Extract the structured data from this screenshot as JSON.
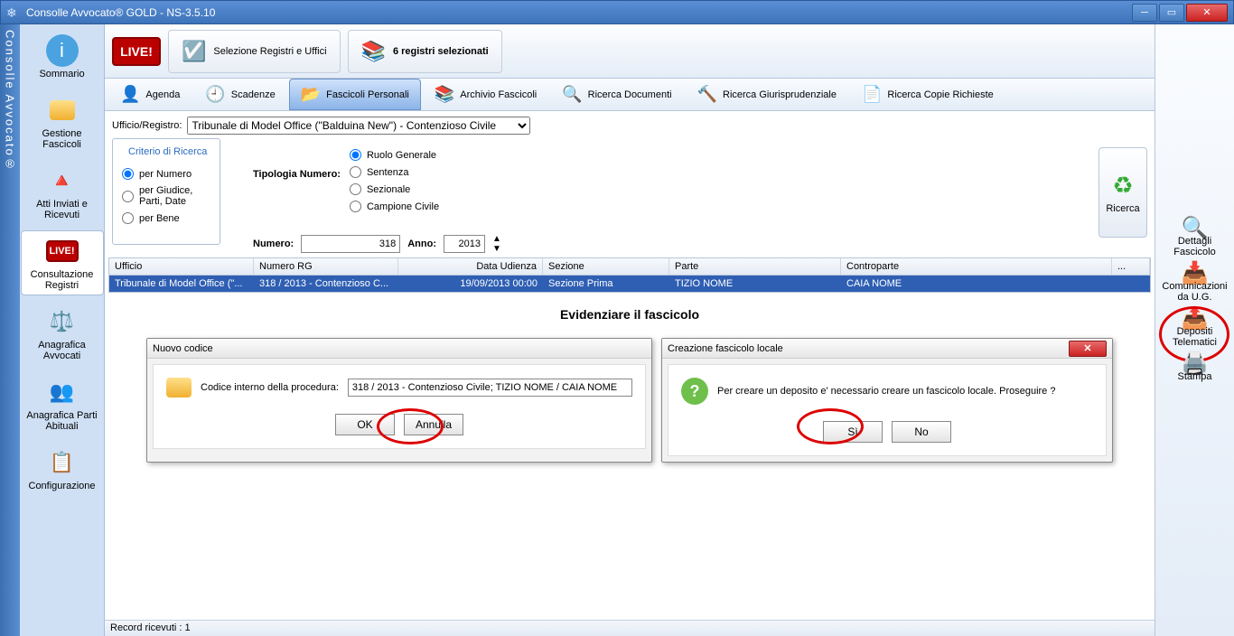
{
  "window": {
    "title": "Consolle Avvocato® GOLD - NS-3.5.10"
  },
  "leftrail": "Consolle Avvocato®",
  "sidebar": [
    {
      "label": "Sommario",
      "icon": "ℹ️"
    },
    {
      "label": "Gestione Fascicoli",
      "icon": "📁"
    },
    {
      "label": "Atti Inviati e Ricevuti",
      "icon": "🔺"
    },
    {
      "label": "Consultazione Registri",
      "icon": "LIVE",
      "active": true
    },
    {
      "label": "Anagrafica Avvocati",
      "icon": "👤"
    },
    {
      "label": "Anagrafica Parti Abituali",
      "icon": "👥"
    },
    {
      "label": "Configurazione",
      "icon": "📋"
    }
  ],
  "topbar": {
    "live": "LIVE!",
    "selezione": "Selezione Registri e Uffici",
    "registri": "6 registri selezionati"
  },
  "subtabs": [
    {
      "label": "Agenda",
      "icon": "👤"
    },
    {
      "label": "Scadenze",
      "icon": "🕘"
    },
    {
      "label": "Fascicoli Personali",
      "icon": "📂",
      "active": true
    },
    {
      "label": "Archivio Fascicoli",
      "icon": "📚"
    },
    {
      "label": "Ricerca Documenti",
      "icon": "🔍"
    },
    {
      "label": "Ricerca Giurisprudenziale",
      "icon": "🔨"
    },
    {
      "label": "Ricerca Copie Richieste",
      "icon": "📄"
    }
  ],
  "filters": {
    "ufficio_label": "Ufficio/Registro:",
    "ufficio_value": "Tribunale di Model Office (\"Balduina New\") - Contenzioso Civile",
    "criterio_legend": "Criterio di Ricerca",
    "crit": [
      "per Numero",
      "per Giudice, Parti, Date",
      "per Bene"
    ],
    "tipologia_label": "Tipologia Numero:",
    "tip": [
      "Ruolo Generale",
      "Sentenza",
      "Sezionale",
      "Campione Civile"
    ],
    "numero_label": "Numero:",
    "numero_value": "318",
    "anno_label": "Anno:",
    "anno_value": "2013",
    "ricerca_btn": "Ricerca"
  },
  "table": {
    "headers": [
      "Ufficio",
      "Numero RG",
      "Data Udienza",
      "Sezione",
      "Parte",
      "Controparte",
      "..."
    ],
    "row": [
      "Tribunale di Model Office (\"...",
      "318 / 2013 - Contenzioso C...",
      "19/09/2013 00:00",
      "Sezione Prima",
      "TIZIO NOME",
      "CAIA NOME",
      ""
    ]
  },
  "evidenziare": "Evidenziare il fascicolo",
  "dialog1": {
    "title": "Nuovo codice",
    "label": "Codice interno della procedura:",
    "value": "318 / 2013 - Contenzioso Civile; TIZIO NOME / CAIA NOME",
    "ok": "OK",
    "cancel": "Annulla"
  },
  "dialog2": {
    "title": "Creazione fascicolo locale",
    "text": "Per creare un deposito e' necessario creare un fascicolo locale. Proseguire ?",
    "yes": "Sì",
    "no": "No"
  },
  "statusbar": "Record ricevuti : 1",
  "rightbar": [
    {
      "label": "Dettagli Fascicolo",
      "icon": "🔍"
    },
    {
      "label": "Comunicazioni da U.G.",
      "icon": "📥"
    },
    {
      "label": "Depositi Telematici",
      "icon": "📤",
      "circled": true
    },
    {
      "label": "Stampa",
      "icon": "🖨️"
    }
  ]
}
